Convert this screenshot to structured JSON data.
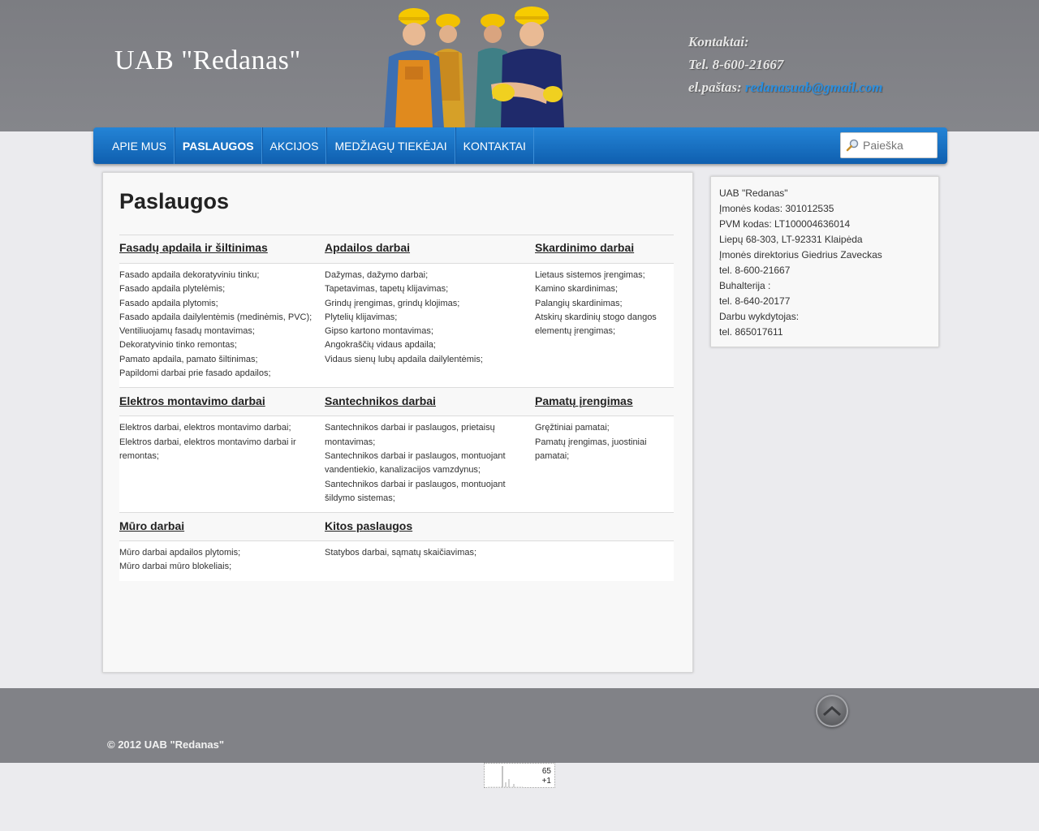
{
  "header": {
    "logo": "UAB \"Redanas\"",
    "contacts_label": "Kontaktai:",
    "phone": "Tel. 8-600-21667",
    "email_label": "el.paštas:",
    "email": "redanasuab@gmail.com"
  },
  "nav": {
    "items": [
      "APIE MUS",
      "PASLAUGOS",
      "AKCIJOS",
      "MEDŽIAGŲ TIEKĖJAI",
      "KONTAKTAI"
    ],
    "active": "PASLAUGOS"
  },
  "search": {
    "placeholder": "Paieška"
  },
  "main": {
    "title": "Paslaugos",
    "rows": [
      [
        {
          "title": "Fasadų apdaila ir šiltinimas",
          "items": [
            "Fasado apdaila dekoratyviniu tinku;",
            "Fasado apdaila plytelėmis;",
            "Fasado apdaila plytomis;",
            "Fasado apdaila dailylentėmis (medinėmis, PVC);",
            "Ventiliuojamų fasadų montavimas;",
            "Dekoratyvinio tinko remontas;",
            "Pamato apdaila, pamato šiltinimas;",
            "Papildomi darbai prie fasado apdailos;"
          ]
        },
        {
          "title": "Apdailos darbai",
          "items": [
            "Dažymas, dažymo darbai;",
            "Tapetavimas, tapetų klijavimas;",
            "Grindų įrengimas, grindų klojimas;",
            "Plytelių klijavimas;",
            "Gipso kartono montavimas;",
            "Angokraščių vidaus apdaila;",
            "Vidaus sienų lubų apdaila dailylentėmis;"
          ]
        },
        {
          "title": "Skardinimo darbai",
          "items": [
            "Lietaus sistemos įrengimas;",
            "Kamino skardinimas;",
            "Palangių skardinimas;",
            "Atskirų skardinių stogo dangos elementų įrengimas;"
          ]
        }
      ],
      [
        {
          "title": "Elektros montavimo darbai",
          "items": [
            "Elektros darbai, elektros montavimo darbai;",
            "Elektros darbai, elektros montavimo darbai ir remontas;"
          ]
        },
        {
          "title": "Santechnikos darbai",
          "items": [
            "Santechnikos darbai ir paslaugos, prietaisų montavimas;",
            "Santechnikos darbai ir paslaugos, montuojant vandentiekio, kanalizacijos vamzdynus;",
            "Santechnikos darbai ir paslaugos, montuojant šildymo sistemas;"
          ]
        },
        {
          "title": "Pamatų įrengimas",
          "items": [
            "Gręžtiniai pamatai;",
            "Pamatų įrengimas, juostiniai pamatai;"
          ]
        }
      ],
      [
        {
          "title": "Mūro darbai",
          "items": [
            "Mūro darbai apdailos plytomis;",
            "Mūro darbai mūro blokeliais;"
          ]
        },
        {
          "title": "Kitos paslaugos",
          "items": [
            "Statybos darbai, sąmatų skaičiavimas;"
          ]
        },
        {
          "title": "",
          "items": []
        }
      ]
    ]
  },
  "sidebar": {
    "lines": [
      "UAB \"Redanas\"",
      "Įmonės kodas: 301012535",
      "PVM kodas: LT100004636014",
      "Liepų 68-303, LT-92331 Klaipėda",
      "Įmonės direktorius Giedrius Zaveckas",
      "tel. 8-600-21667",
      "Buhalterija :",
      "tel. 8-640-20177",
      "Darbu wykdytojas:",
      "tel. 865017611"
    ]
  },
  "footer": {
    "copyright": "© 2012 UAB \"Redanas\"",
    "back_to_top_icon": "chevron-up-icon"
  },
  "counter": {
    "total": "65",
    "today": "+1"
  }
}
